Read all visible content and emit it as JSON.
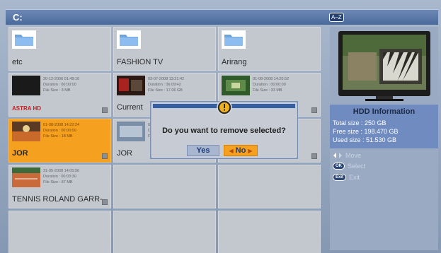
{
  "title_bar": {
    "drive": "C:",
    "sort_label": "A–Z"
  },
  "grid": {
    "folders": [
      {
        "name": "etc"
      },
      {
        "name": "FASHION TV"
      },
      {
        "name": "Arirang"
      }
    ],
    "recordings": [
      {
        "date": "20-12-2006 01:49:16",
        "duration": "Duration :  00:00:00",
        "filesize": "File Size :   3 MB",
        "name": "ASTRA HD"
      },
      {
        "date": "03-07-2008 13:21:42",
        "duration": "Duration :  06:09:42",
        "filesize": "File Size :  17.06 GB",
        "name": "Current"
      },
      {
        "date": "01-08-2008 14:20:52",
        "duration": "Duration :  00:00:00",
        "filesize": "File Size :   33 MB",
        "name": ""
      },
      {
        "date": "01-08-2008 14:22:24",
        "duration": "Duration :  00:00:00",
        "filesize": "File Size :   18 MB",
        "name": "JOR"
      },
      {
        "date": "01",
        "duration": "D",
        "filesize": "Fi",
        "name": "JOR"
      },
      {
        "date": "",
        "duration": "",
        "filesize": "",
        "name": ""
      },
      {
        "date": "31-05-2008 14:05:56",
        "duration": "Duration :  00:03:30",
        "filesize": "File Size :   87 MB",
        "name": "TENNIS ROLAND GARR-"
      }
    ]
  },
  "side_panel": {
    "hdd_title": "HDD Information",
    "total_size": "Total size : 250 GB",
    "free_size": "Free size : 198.470 GB",
    "used_size": "Used size : 51.530 GB",
    "help": {
      "move": "Move",
      "ok_key": "OK",
      "select": "Select",
      "exit_key": "Exit",
      "exit": "Exit"
    }
  },
  "dialog": {
    "question": "Do you want to remove selected?",
    "yes_label": "Yes",
    "no_label": "No"
  },
  "colors": {
    "selected": "#f5a01e",
    "accent_blue": "#365ea3",
    "cell": "#c3c8cf"
  }
}
